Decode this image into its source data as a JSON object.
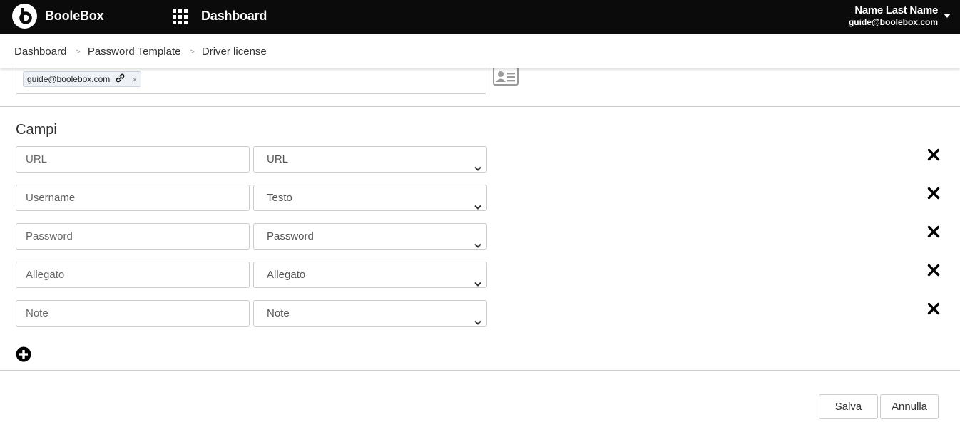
{
  "header": {
    "app_name": "BooleBox",
    "page_name": "Dashboard",
    "user_name": "Name Last Name",
    "user_email": "guide@boolebox.com"
  },
  "breadcrumb": {
    "items": [
      "Dashboard",
      "Password Template",
      "Driver license"
    ],
    "separator": ">"
  },
  "share": {
    "chip_label": "guide@boolebox.com",
    "chip_remove": "×"
  },
  "fields_section": {
    "title": "Campi",
    "rows": [
      {
        "name_placeholder": "URL",
        "type": "URL"
      },
      {
        "name_placeholder": "Username",
        "type": "Testo"
      },
      {
        "name_placeholder": "Password",
        "type": "Password"
      },
      {
        "name_placeholder": "Allegato",
        "type": "Allegato"
      },
      {
        "name_placeholder": "Note",
        "type": "Note"
      }
    ]
  },
  "actions": {
    "save_label": "Salva",
    "cancel_label": "Annulla"
  },
  "icons": {
    "logo": "boolebox-logo-icon",
    "apps": "apps-grid-icon",
    "user_menu": "caret-down-icon",
    "chip_link": "link-icon",
    "contact_card": "contact-card-icon",
    "row_delete": "close-icon",
    "row_type_chevron": "chevron-down-icon",
    "add_row": "plus-circle-icon"
  },
  "colors": {
    "topbar_bg": "#0b0b0b",
    "border": "#cccccc",
    "chip_bg": "#eef2f7"
  }
}
